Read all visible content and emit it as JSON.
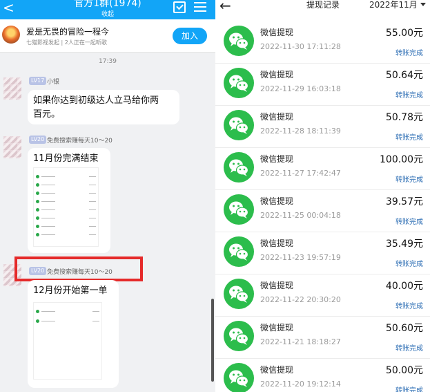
{
  "chat": {
    "title": "官方1群(1974)",
    "subtitle": "收起",
    "back": "<",
    "pinned": {
      "title": "爱是无畏的冒险一程今",
      "meta": "七猫影视发起 | 2人正在一起听歌",
      "join_label": "加入"
    },
    "time": "17:39",
    "messages": [
      {
        "level": "LV17",
        "name": "小银",
        "text_line1": "如果你达到初级达人立马给你两",
        "text_line2": "百元。"
      },
      {
        "level": "LV20",
        "name": "免费搜索赚每天10～20",
        "text": "11月份完满结束"
      },
      {
        "level": "LV20",
        "name": "免费搜索赚每天10～20",
        "text": "12月份开始第一单"
      }
    ]
  },
  "withdraw": {
    "back": "←",
    "title": "提现记录",
    "month": "2022年11月",
    "records": [
      {
        "title": "微信提现",
        "time": "2022-11-30 17:11:28",
        "amount": "55.00元",
        "status": "转账完成"
      },
      {
        "title": "微信提现",
        "time": "2022-11-29 16:03:18",
        "amount": "50.64元",
        "status": "转账完成"
      },
      {
        "title": "微信提现",
        "time": "2022-11-28 18:11:39",
        "amount": "50.78元",
        "status": "转账完成"
      },
      {
        "title": "微信提现",
        "time": "2022-11-27 17:42:47",
        "amount": "100.00元",
        "status": "转账完成"
      },
      {
        "title": "微信提现",
        "time": "2022-11-25 00:04:18",
        "amount": "39.57元",
        "status": "转账完成"
      },
      {
        "title": "微信提现",
        "time": "2022-11-23 19:57:19",
        "amount": "35.49元",
        "status": "转账完成"
      },
      {
        "title": "微信提现",
        "time": "2022-11-22 20:30:20",
        "amount": "40.00元",
        "status": "转账完成"
      },
      {
        "title": "微信提现",
        "time": "2022-11-21 18:18:27",
        "amount": "50.60元",
        "status": "转账完成"
      },
      {
        "title": "微信提现",
        "time": "2022-11-20 19:12:14",
        "amount": "50.00元",
        "status": "转账完成"
      }
    ]
  },
  "colors": {
    "qq_blue": "#12a5f7",
    "wechat_green": "#2cbd4c",
    "highlight_red": "#e52a2a",
    "status_blue": "#2f6fb5"
  }
}
